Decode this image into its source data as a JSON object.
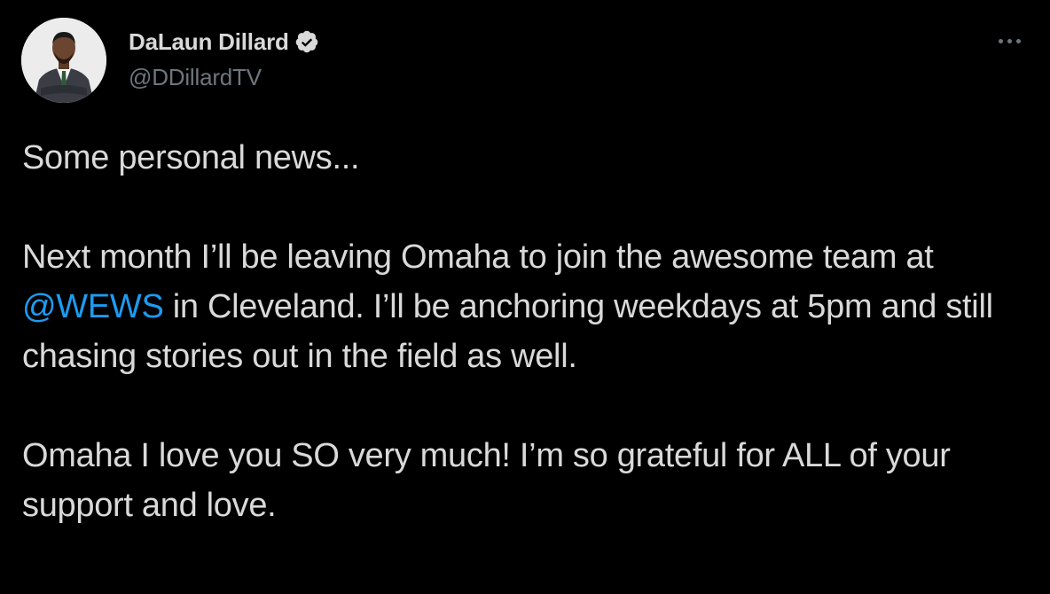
{
  "author": {
    "name": "DaLaun Dillard",
    "handle": "@DDillardTV",
    "verified": true,
    "avatar_icon": "profile-photo"
  },
  "menu": {
    "icon": "more-horizontal-icon"
  },
  "tweet": {
    "line1": "Some personal news...",
    "para2_before": "Next month I’ll be leaving Omaha to join the awesome team at ",
    "mention": "@WEWS",
    "para2_after": " in Cleveland. I’ll be anchoring weekdays at 5pm and still chasing stories out in the field as well.",
    "para3": "Omaha I love you SO very much! I’m so grateful for ALL of your support and love."
  },
  "colors": {
    "background": "#000000",
    "text": "#d9d9d9",
    "secondary": "#6e767d",
    "link": "#1d9bf0"
  }
}
